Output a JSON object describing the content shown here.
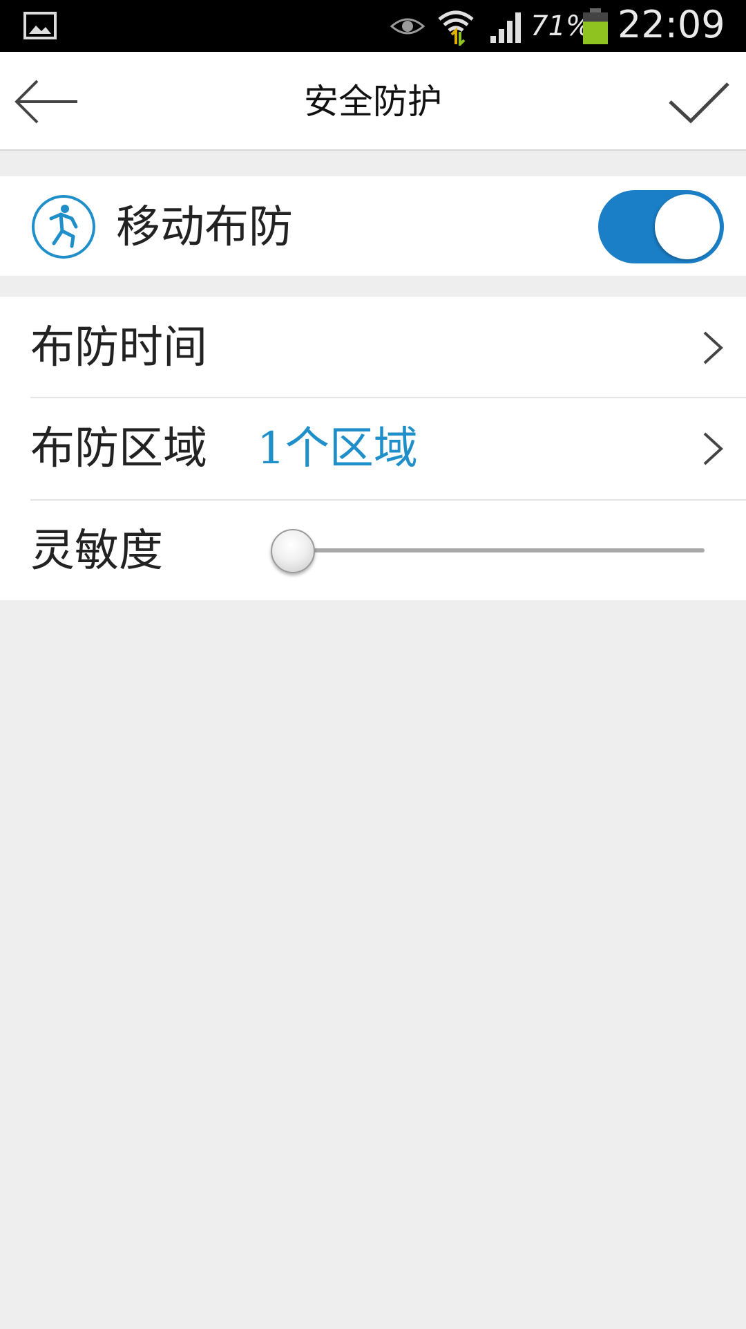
{
  "status_bar": {
    "battery_percent": "71%",
    "clock": "22:09",
    "battery_level": 0.71,
    "battery_color": "#8fc31f",
    "icons": [
      "gallery-icon",
      "eye-icon",
      "wifi-icon",
      "signal-icon",
      "battery-icon"
    ]
  },
  "app_bar": {
    "title": "安全防护",
    "back_icon": "arrow-left-icon",
    "confirm_icon": "check-icon"
  },
  "motion_detection": {
    "label": "移动布防",
    "icon": "running-man-icon",
    "enabled": true,
    "accent_color": "#1b7fc7"
  },
  "settings": {
    "schedule": {
      "label": "布防时间",
      "icon": "chevron-right-icon"
    },
    "zone": {
      "label": "布防区域",
      "value": "1个区域",
      "value_color": "#1f8fc9",
      "icon": "chevron-right-icon"
    },
    "sensitivity": {
      "label": "灵敏度",
      "level": 0.0
    }
  }
}
